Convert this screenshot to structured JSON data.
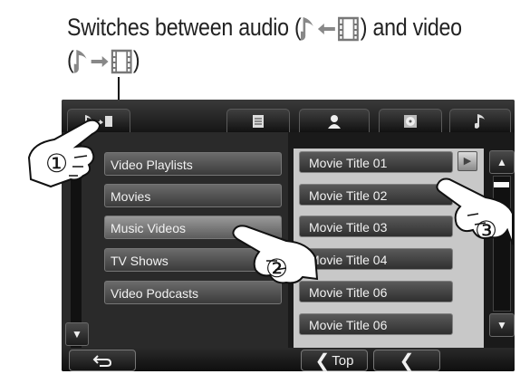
{
  "caption": {
    "line1_prefix": "Switches between audio (",
    "line1_suffix": ") and video",
    "line2_prefix": "(",
    "line2_suffix": ")"
  },
  "tabs": [
    {
      "icon": "audio-video-switch-icon"
    },
    {
      "icon": "document-icon"
    },
    {
      "icon": "person-icon"
    },
    {
      "icon": "disc-icon"
    },
    {
      "icon": "music-note-icon"
    }
  ],
  "categories": [
    {
      "label": "Video Playlists"
    },
    {
      "label": "Movies"
    },
    {
      "label": "Music Videos"
    },
    {
      "label": "TV Shows"
    },
    {
      "label": "Video Podcasts"
    }
  ],
  "items": [
    {
      "label": "Movie Title 01"
    },
    {
      "label": "Movie Title 02"
    },
    {
      "label": "Movie Title 03"
    },
    {
      "label": "Movie Title 04"
    },
    {
      "label": "Movie Title 06"
    },
    {
      "label": "Movie Title 06"
    }
  ],
  "bottom": {
    "top_label": "Top",
    "back_icon": "return-icon",
    "prev_icon": "chevron-left-icon"
  },
  "steps": [
    "①",
    "②",
    "③"
  ],
  "colors": {
    "screen_bg": "#1a1a1a",
    "list_pane": "#c8c8c8"
  }
}
